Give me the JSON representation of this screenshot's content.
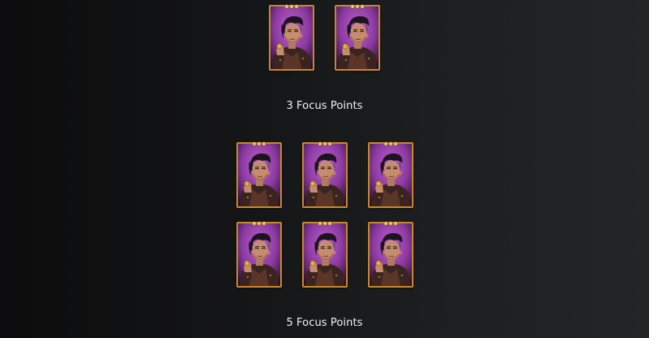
{
  "sections": [
    {
      "caption": "3 Focus Points",
      "rows": [
        {
          "cards": [
            {
              "character": "focus-card-portrait"
            },
            {
              "character": "focus-card-portrait"
            }
          ]
        }
      ]
    },
    {
      "caption": "5 Focus Points",
      "rows": [
        {
          "cards": [
            {
              "character": "focus-card-portrait"
            },
            {
              "character": "focus-card-portrait"
            },
            {
              "character": "focus-card-portrait"
            }
          ]
        },
        {
          "cards": [
            {
              "character": "focus-card-portrait"
            },
            {
              "character": "focus-card-portrait"
            },
            {
              "character": "focus-card-portrait"
            }
          ]
        }
      ]
    }
  ],
  "colors": {
    "card_border": "#c9892a",
    "card_bg_top": "#8a3aa0",
    "card_bg_bottom": "#2a1030",
    "text": "#f2f2f2"
  }
}
